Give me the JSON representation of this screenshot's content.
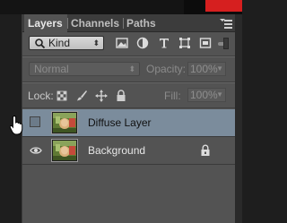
{
  "tabs": [
    {
      "label": "Layers",
      "active": true
    },
    {
      "label": "Channels",
      "active": false
    },
    {
      "label": "Paths",
      "active": false
    }
  ],
  "filter": {
    "kind_label": "Kind",
    "icons": [
      "image-filter-icon",
      "adjustment-filter-icon",
      "type-filter-icon",
      "shape-filter-icon",
      "smart-object-filter-icon"
    ]
  },
  "blend": {
    "mode": "Normal",
    "opacity_label": "Opacity:",
    "opacity_value": "100%"
  },
  "lock": {
    "label": "Lock:",
    "fill_label": "Fill:",
    "fill_value": "100%"
  },
  "layers": [
    {
      "name": "Diffuse Layer",
      "selected": true,
      "visible": false,
      "locked": false
    },
    {
      "name": "Background",
      "selected": false,
      "visible": true,
      "locked": true
    }
  ],
  "colors": {
    "panel_bg": "#535353",
    "tab_bar_bg": "#3c3c3c",
    "selected_row": "#7b8c9c",
    "accent_red": "#d61f1f"
  }
}
